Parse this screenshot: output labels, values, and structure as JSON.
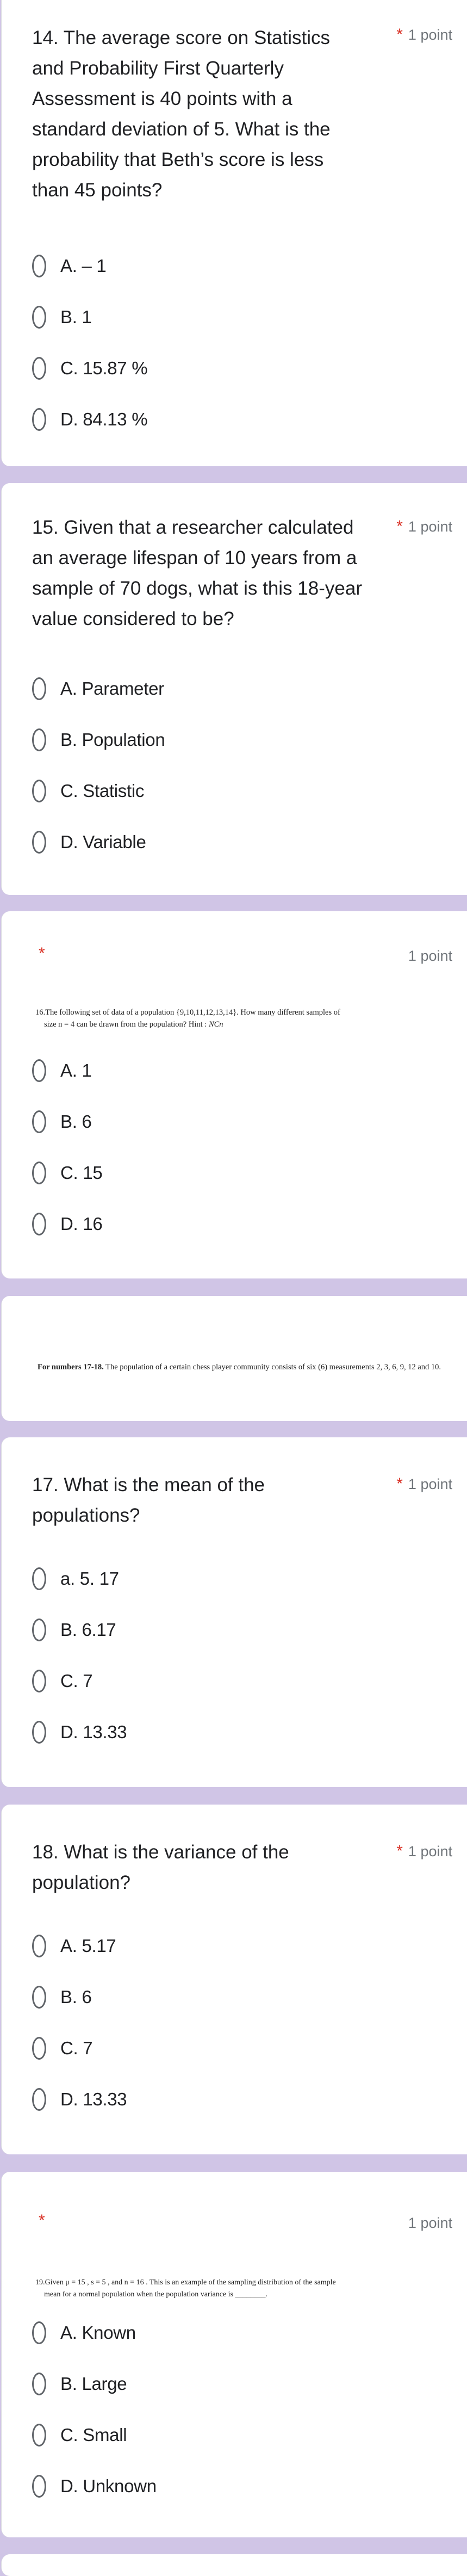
{
  "colors": {
    "page_background": "#d0c5e6",
    "card_background": "#ffffff",
    "required_star": "#d93025",
    "points_text": "#70757a",
    "radio_border": "#5f6368"
  },
  "questions": [
    {
      "id": "q14",
      "title": "14. The average score on Statistics and Probability First Quarterly Assessment is 40 points with a standard deviation of 5. What is the probability that Beth’s score is less than 45 points?",
      "required_marker": "*",
      "points": "1 point",
      "options": [
        "A. – 1",
        "B. 1",
        "C. 15.87 %",
        "D. 84.13 %"
      ]
    },
    {
      "id": "q15",
      "title": "15. Given that a researcher calculated an average lifespan of 10 years from a sample of 70 dogs, what is this 18-year value considered to be?",
      "required_marker": "*",
      "points": "1 point",
      "options": [
        "A. Parameter",
        "B. Population",
        "C. Statistic",
        "D. Variable"
      ]
    },
    {
      "id": "q16",
      "required_marker": "*",
      "points": "1 point",
      "image_text_line1": "16.The following set of data of a population {9,10,11,12,13,14}. How many different samples of",
      "image_text_line2": "size n = 4 can be drawn from the population? Hint : ",
      "image_text_hint": "NCn",
      "options": [
        "A. 1",
        "B. 6",
        "C. 15",
        "D. 16"
      ]
    },
    {
      "id": "q17",
      "title": "17. What is the mean of the populations?",
      "required_marker": "*",
      "points": "1 point",
      "options": [
        "a. 5. 17",
        "B. 6.17",
        "C. 7",
        "D. 13.33"
      ]
    },
    {
      "id": "q18",
      "title": "18. What is the variance of the population?",
      "required_marker": "*",
      "points": "1 point",
      "options": [
        "A. 5.17",
        "B. 6",
        "C. 7",
        "D. 13.33"
      ]
    },
    {
      "id": "q19",
      "required_marker": "*",
      "points": "1 point",
      "image_text_line1": "19.Given μ = 15 , s = 5 , and n = 16 . This is an example of the sampling distribution of the sample",
      "image_text_line2": "mean for a normal population when the population variance is ________.",
      "options": [
        "A. Known",
        "B. Large",
        "C. Small",
        "D. Unknown"
      ]
    }
  ],
  "info_block": {
    "bold_prefix": "For numbers 17-18.",
    "text": " The population of a certain chess player community consists of six (6) measurements 2, 3, 6, 9, 12 and 10."
  }
}
